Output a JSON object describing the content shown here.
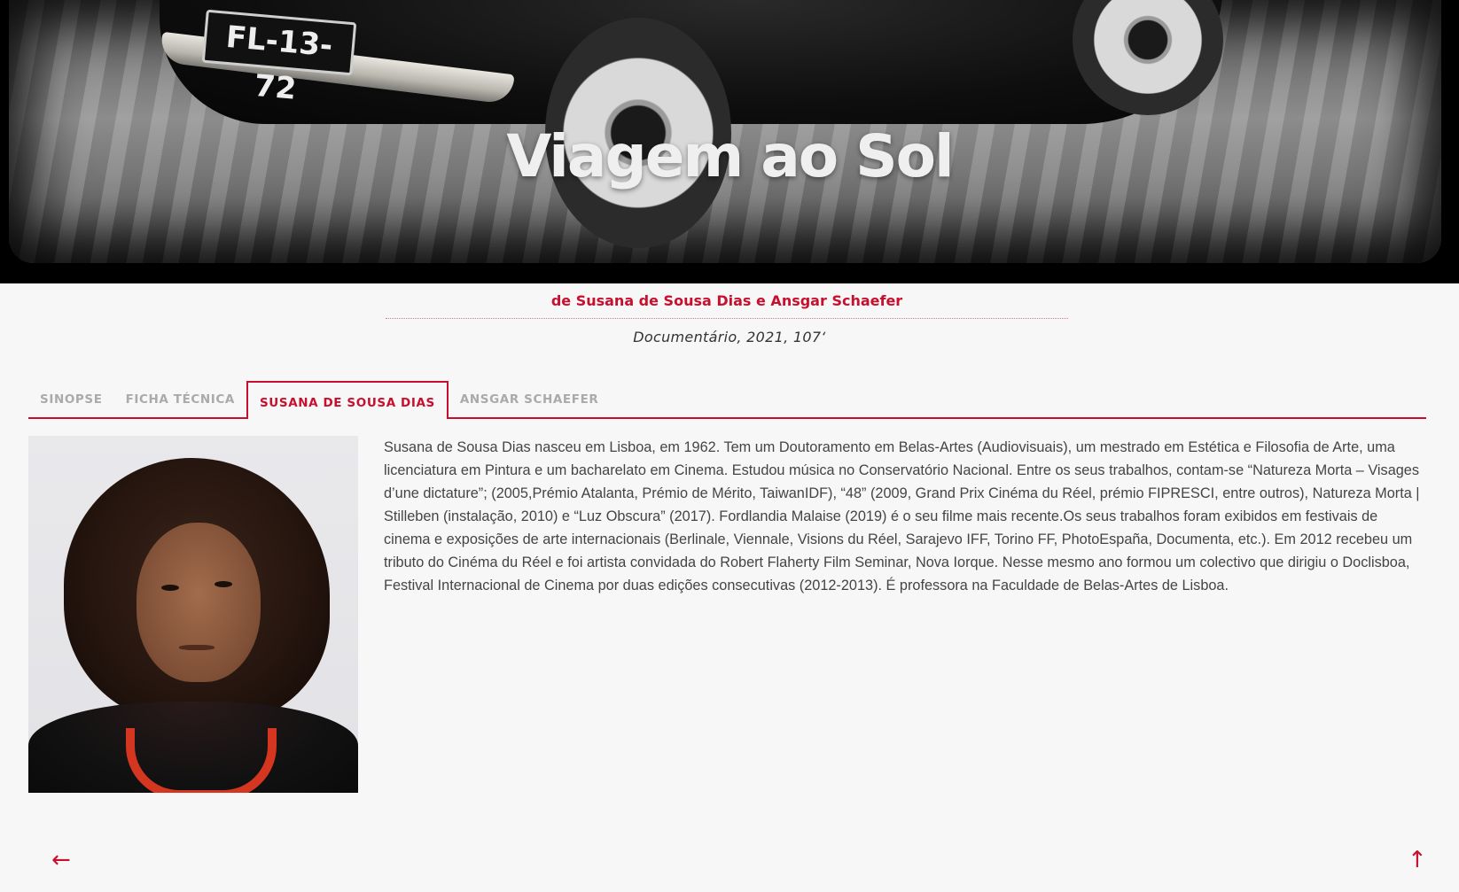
{
  "hero": {
    "title": "Viagem ao Sol",
    "plate_text": "FL-13-72"
  },
  "film": {
    "directors": "de Susana de Sousa Dias e Ansgar Schaefer",
    "genre_line": "Documentário, 2021, 107‘"
  },
  "tabs": [
    {
      "label": "SINOPSE",
      "active": false
    },
    {
      "label": "FICHA TÉCNICA",
      "active": false
    },
    {
      "label": "SUSANA DE SOUSA DIAS",
      "active": true
    },
    {
      "label": "ANSGAR SCHAEFER",
      "active": false
    }
  ],
  "bio": {
    "text": "Susana de Sousa Dias nasceu em Lisboa, em 1962. Tem um Doutoramento em Belas-Artes (Audiovisuais), um mestrado em Estética e Filosofia de Arte, uma licenciatura em Pintura e um bacharelato em Cinema. Estudou música no Conservatório Nacional. Entre os seus trabalhos, contam-se “Natureza Morta – Visages d’une dictature”; (2005,Prémio Atalanta, Prémio de Mérito, TaiwanIDF), “48” (2009, Grand Prix Cinéma du Réel, prémio FIPRESCI, entre outros), Natureza Morta | Stilleben (instalação, 2010) e “Luz Obscura” (2017). Fordlandia Malaise (2019) é o seu filme mais recente.Os seus trabalhos foram exibidos em festivais de cinema e exposições de arte internacionais (Berlinale, Viennale, Visions du Réel, Sarajevo IFF, Torino FF, PhotoEspaña, Documenta, etc.). Em 2012 recebeu um tributo do Cinéma du Réel e foi artista convidada do Robert Flaherty Film Seminar, Nova Iorque. Nesse mesmo ano formou um colectivo que dirigiu o Doclisboa, Festival Internacional de Cinema por duas edições consecutivas (2012-2013). É professora na Faculdade de Belas-Artes de Lisboa."
  },
  "nav": {
    "back_glyph": "←",
    "top_glyph": "↑"
  },
  "colors": {
    "accent": "#c8102e",
    "background": "#f7f7f7",
    "muted_tab": "#aaaaaa"
  }
}
